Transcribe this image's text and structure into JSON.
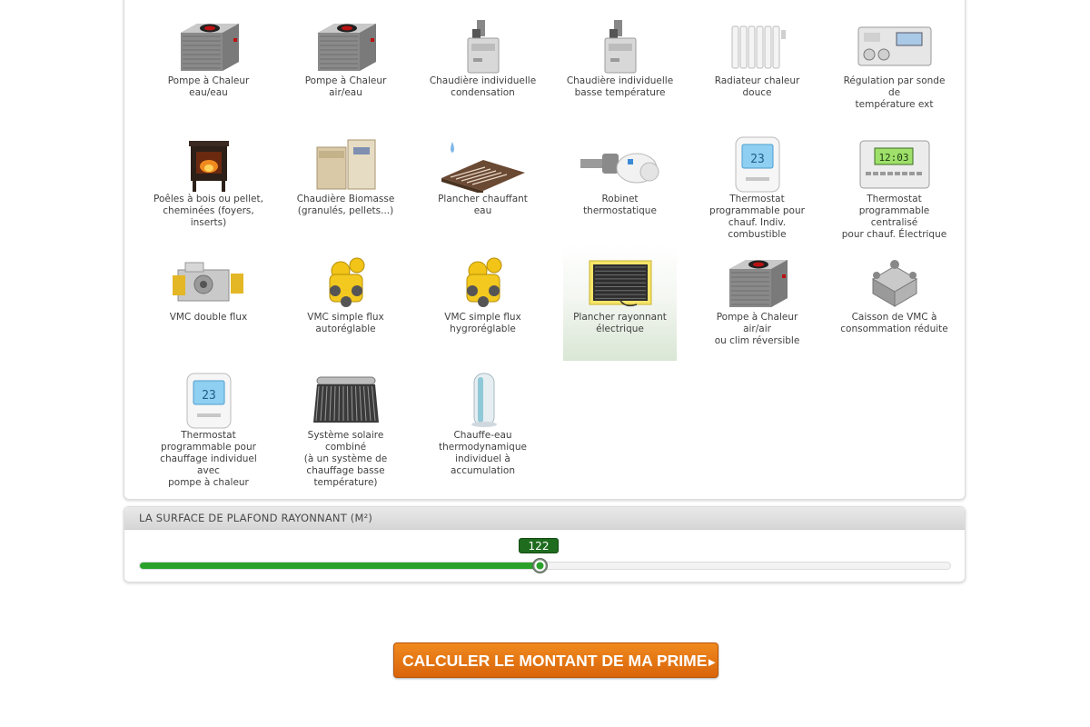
{
  "products": [
    {
      "label": "Pompe à Chaleur\neau/eau",
      "icon": "heat-pump-icon"
    },
    {
      "label": "Pompe à Chaleur air/eau",
      "icon": "heat-pump-icon"
    },
    {
      "label": "Chaudière individuelle\ncondensation",
      "icon": "boiler-icon"
    },
    {
      "label": "Chaudière individuelle\nbasse température",
      "icon": "boiler-icon"
    },
    {
      "label": "Radiateur chaleur douce",
      "icon": "radiator-icon"
    },
    {
      "label": "Régulation par sonde de\ntempérature ext",
      "icon": "regulator-icon"
    },
    {
      "label": "Poêles à bois ou pellet,\ncheminées (foyers,\ninserts)",
      "icon": "stove-icon"
    },
    {
      "label": "Chaudière Biomasse\n(granulés, pellets...)",
      "icon": "biomass-boiler-icon"
    },
    {
      "label": "Plancher chauffant eau",
      "icon": "water-floor-heating-icon"
    },
    {
      "label": "Robinet thermostatique",
      "icon": "thermostatic-valve-icon"
    },
    {
      "label": "Thermostat\nprogrammable pour\nchauf. Indiv. combustible",
      "icon": "thermostat-icon"
    },
    {
      "label": "Thermostat\nprogrammable centralisé\npour chauf. Électrique",
      "icon": "central-thermostat-icon"
    },
    {
      "label": "VMC double flux",
      "icon": "vmc-double-flux-icon"
    },
    {
      "label": "VMC simple flux\nautoréglable",
      "icon": "vmc-simple-flux-icon"
    },
    {
      "label": "VMC simple flux\nhygroréglable",
      "icon": "vmc-simple-flux-icon"
    },
    {
      "label": "Plancher rayonnant\nélectrique",
      "icon": "electric-floor-heating-icon",
      "selected": true
    },
    {
      "label": "Pompe à Chaleur air/air\nou clim réversible",
      "icon": "heat-pump-icon"
    },
    {
      "label": "Caisson de VMC à\nconsommation réduite",
      "icon": "vmc-box-icon"
    },
    {
      "label": "Thermostat\nprogrammable pour\nchauffage individuel avec\npompe à chaleur",
      "icon": "thermostat-icon"
    },
    {
      "label": "Système solaire combiné\n(à un système de\nchauffage basse\ntempérature)",
      "icon": "solar-collector-icon"
    },
    {
      "label": "Chauffe-eau\nthermodynamique\nindividuel à accumulation",
      "icon": "water-heater-icon"
    }
  ],
  "slider": {
    "title": "LA SURFACE DE PLAFOND RAYONNANT (M²)",
    "value": "122",
    "fraction": 0.492
  },
  "cta": {
    "label": "CALCULER LE MONTANT DE MA PRIME",
    "arrow": "►"
  },
  "colors": {
    "slider_fill": "#2aa22a",
    "slider_value_bg": "#1f6c1f",
    "cta_top": "#f08a1f",
    "cta_bottom": "#d9650a"
  }
}
